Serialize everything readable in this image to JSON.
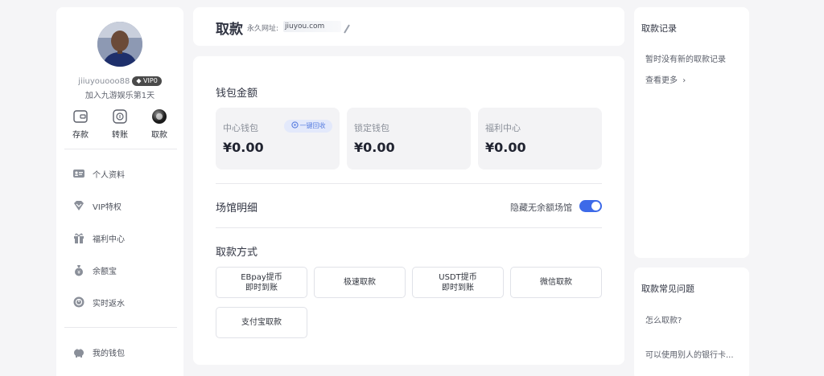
{
  "sidebar": {
    "username": "jiiuyouooo88",
    "vip_level": "VIP0",
    "join_text": "加入九游娱乐第1天",
    "quick_actions": [
      {
        "label": "存款",
        "icon": "wallet-icon"
      },
      {
        "label": "转账",
        "icon": "transfer-icon"
      },
      {
        "label": "取款",
        "icon": "withdraw-icon",
        "active": true
      }
    ],
    "menu": [
      {
        "label": "个人资料",
        "icon": "id-card-icon"
      },
      {
        "label": "VIP特权",
        "icon": "vip-heart-icon"
      },
      {
        "label": "福利中心",
        "icon": "gift-icon"
      },
      {
        "label": "余额宝",
        "icon": "money-bag-icon"
      },
      {
        "label": "实时返水",
        "icon": "rebate-icon"
      }
    ],
    "wallet_item": {
      "label": "我的钱包",
      "icon": "piggy-bank-icon"
    }
  },
  "header": {
    "title": "取款",
    "permanent_label": "永久网址:",
    "permanent_url": "jiuyou.com"
  },
  "main": {
    "wallet_title": "钱包金额",
    "wallets": [
      {
        "name": "中心钱包",
        "amount": "¥0.00",
        "action": "一键回收"
      },
      {
        "name": "锁定钱包",
        "amount": "¥0.00"
      },
      {
        "name": "福利中心",
        "amount": "¥0.00"
      }
    ],
    "venue_title": "场馆明细",
    "hide_empty_label": "隐藏无余额场馆",
    "hide_empty_on": true,
    "methods_title": "取款方式",
    "methods": [
      {
        "line1": "EBpay提币",
        "line2": "即时到账"
      },
      {
        "line1": "极速取款",
        "line2": ""
      },
      {
        "line1": "USDT提币",
        "line2": "即时到账"
      },
      {
        "line1": "微信取款",
        "line2": ""
      },
      {
        "line1": "支付宝取款",
        "line2": ""
      }
    ]
  },
  "records": {
    "title": "取款记录",
    "empty_text": "暂时没有新的取款记录",
    "more_label": "查看更多"
  },
  "faq": {
    "title": "取款常见问题",
    "questions": [
      "怎么取款?",
      "可以使用别人的银行卡..."
    ]
  },
  "colors": {
    "accent": "#3d6ae8",
    "background": "#f5f5f7",
    "card": "#f3f3f5"
  }
}
